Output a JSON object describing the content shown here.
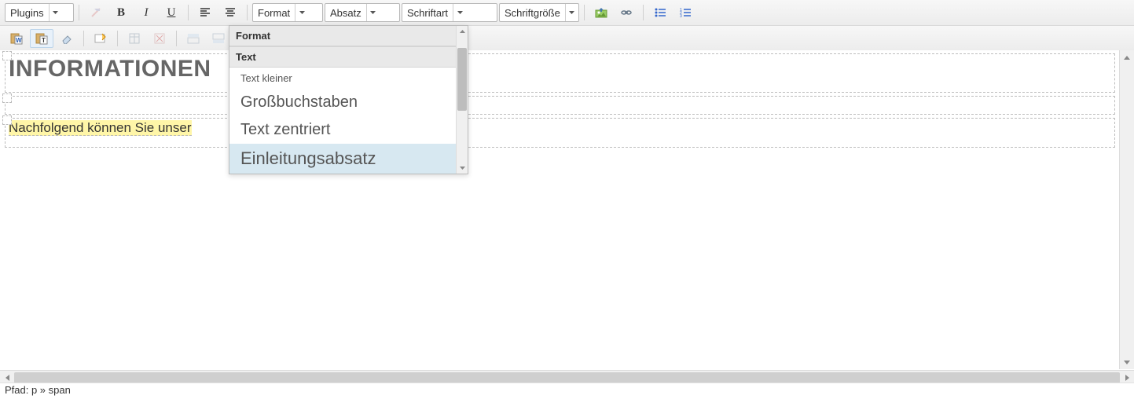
{
  "toolbar1": {
    "plugins": "Plugins",
    "format": "Format",
    "absatz": "Absatz",
    "schriftart": "Schriftart",
    "schriftgroesse": "Schriftgröße"
  },
  "format_menu": {
    "header": "Format",
    "subheader": "Text",
    "items": [
      {
        "label": "Text kleiner",
        "style": "small"
      },
      {
        "label": "Großbuchstaben",
        "style": "big"
      },
      {
        "label": "Text zentriert",
        "style": "big"
      },
      {
        "label": "Einleitungsabsatz",
        "style": "bigger",
        "hover": true
      }
    ]
  },
  "content": {
    "heading": "INFORMATIONEN",
    "para": "Nachfolgend können Sie unser"
  },
  "status": {
    "path": "Pfad: p » span"
  }
}
